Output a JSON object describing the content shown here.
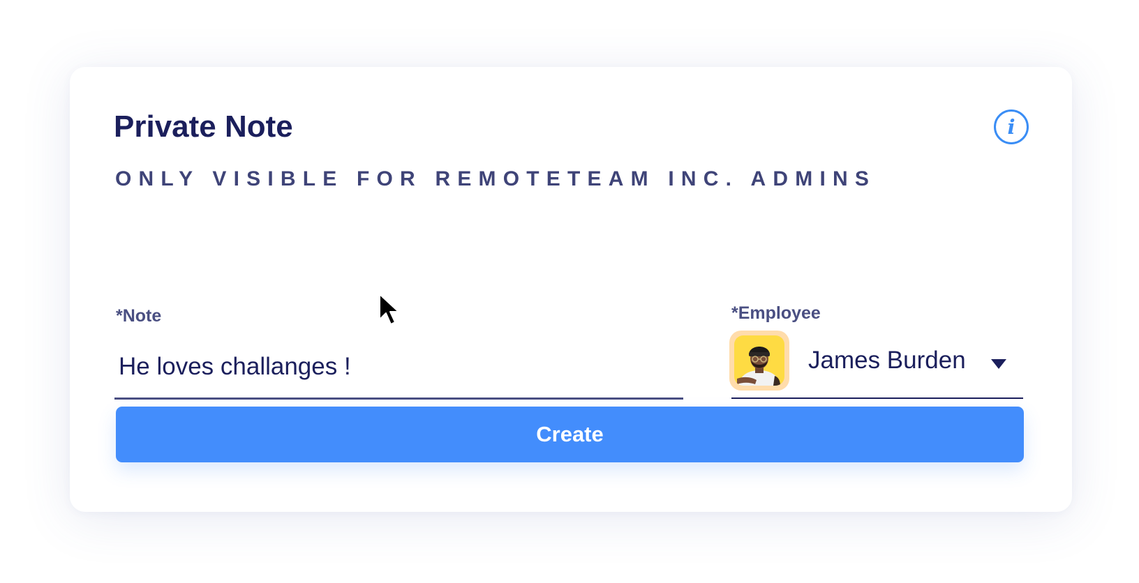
{
  "card": {
    "title": "Private Note",
    "subtitle": "ONLY VISIBLE FOR REMOTETEAM INC. ADMINS",
    "info_icon": "info-icon",
    "info_glyph": "i"
  },
  "form": {
    "note": {
      "label": "*Note",
      "value": "He loves challanges !"
    },
    "employee": {
      "label": "*Employee",
      "selected_name": "James Burden",
      "avatar_icon": "employee-avatar",
      "dropdown_icon": "caret-down-icon"
    }
  },
  "actions": {
    "create_label": "Create"
  },
  "colors": {
    "title": "#1b1f5c",
    "subtitle": "#3f4478",
    "accent": "#438dfc",
    "info": "#3a8df5",
    "avatar_bg": "#fedb43",
    "avatar_ring": "#ffdcab"
  }
}
